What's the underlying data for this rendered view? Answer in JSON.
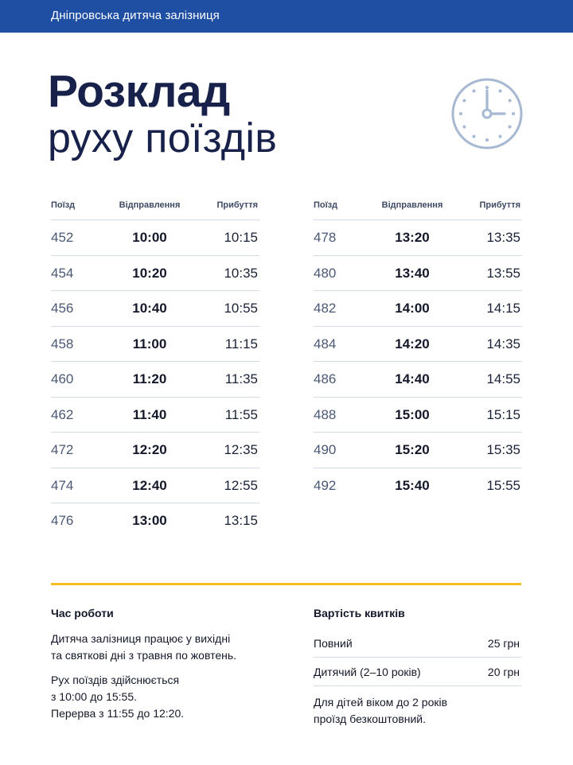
{
  "header": {
    "title": "Дніпровська дитяча залізниця"
  },
  "page": {
    "title_line1": "Розклад",
    "title_line2": "руху поїздів"
  },
  "icons": {
    "clock": "clock-icon"
  },
  "colors": {
    "header_bg": "#1f4fa3",
    "title": "#17214a",
    "accent_line": "#f5bf24",
    "clock": "#a7b8d3"
  },
  "schedule": {
    "columns": [
      "Поїзд",
      "Відправлення",
      "Прибуття"
    ],
    "left": [
      {
        "train": "452",
        "departure": "10:00",
        "arrival": "10:15"
      },
      {
        "train": "454",
        "departure": "10:20",
        "arrival": "10:35"
      },
      {
        "train": "456",
        "departure": "10:40",
        "arrival": "10:55"
      },
      {
        "train": "458",
        "departure": "11:00",
        "arrival": "11:15"
      },
      {
        "train": "460",
        "departure": "11:20",
        "arrival": "11:35"
      },
      {
        "train": "462",
        "departure": "11:40",
        "arrival": "11:55"
      },
      {
        "train": "472",
        "departure": "12:20",
        "arrival": "12:35"
      },
      {
        "train": "474",
        "departure": "12:40",
        "arrival": "12:55"
      },
      {
        "train": "476",
        "departure": "13:00",
        "arrival": "13:15"
      }
    ],
    "right": [
      {
        "train": "478",
        "departure": "13:20",
        "arrival": "13:35"
      },
      {
        "train": "480",
        "departure": "13:40",
        "arrival": "13:55"
      },
      {
        "train": "482",
        "departure": "14:00",
        "arrival": "14:15"
      },
      {
        "train": "484",
        "departure": "14:20",
        "arrival": "14:35"
      },
      {
        "train": "486",
        "departure": "14:40",
        "arrival": "14:55"
      },
      {
        "train": "488",
        "departure": "15:00",
        "arrival": "15:15"
      },
      {
        "train": "490",
        "departure": "15:20",
        "arrival": "15:35"
      },
      {
        "train": "492",
        "departure": "15:40",
        "arrival": "15:55"
      }
    ]
  },
  "hours": {
    "title": "Час роботи",
    "para1_line1": "Дитяча залізниця працює у вихідні",
    "para1_line2": "та святкові дні з травня по жовтень.",
    "para2_line1": "Рух поїздів здійснюється",
    "para2_line2": "з 10:00 до 15:55.",
    "para2_line3": "Перерва з 11:55 до 12:20."
  },
  "prices": {
    "title": "Вартість квитків",
    "items": [
      {
        "label": "Повний",
        "value": "25 грн"
      },
      {
        "label": "Дитячий (2–10 років)",
        "value": "20 грн"
      }
    ],
    "note_line1": "Для дітей віком до 2 років",
    "note_line2": "проїзд безкоштовний."
  }
}
